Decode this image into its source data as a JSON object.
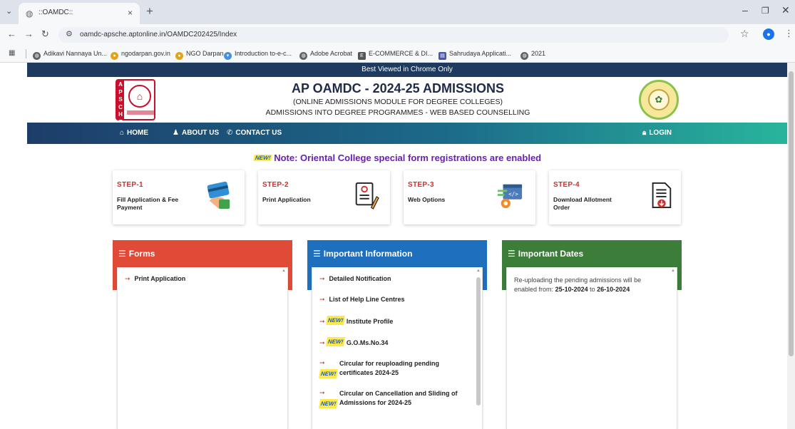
{
  "browser": {
    "tab_title": "::OAMDC::",
    "url": "oamdc-apsche.aptonline.in/OAMDC202425/Index",
    "bookmarks": [
      {
        "label": "Adikavi Nannaya Un...",
        "color": "#5f6368"
      },
      {
        "label": "ngodarpan.gov.in",
        "color": "#e3a21a"
      },
      {
        "label": "NGO Darpan",
        "color": "#e3a21a"
      },
      {
        "label": "Introduction to-e-c...",
        "color": "#4a90d9"
      },
      {
        "label": "Adobe Acrobat",
        "color": "#5f6368"
      },
      {
        "label": "E-COMMERCE & DI...",
        "color": "#555555"
      },
      {
        "label": "Sahrudaya Applicati...",
        "color": "#4757b8"
      },
      {
        "label": "2021",
        "color": "#5f6368"
      }
    ]
  },
  "site": {
    "banner": "Best Viewed in Chrome Only",
    "logo_letters": "APSCHE",
    "title": "AP OAMDC - 2024-25 ADMISSIONS",
    "subtitle1": "(ONLINE ADMISSIONS MODULE FOR DEGREE COLLEGES)",
    "subtitle2": "ADMISSIONS INTO DEGREE PROGRAMMES - WEB BASED COUNSELLING"
  },
  "nav": {
    "home": "HOME",
    "about": "ABOUT US",
    "contact": "CONTACT US",
    "login": "LOGIN"
  },
  "notice": {
    "badge": "NEW!",
    "text": "Note: Oriental College special form registrations are enabled"
  },
  "steps": [
    {
      "title": "STEP-1",
      "text": "Fill Application & Fee Payment"
    },
    {
      "title": "STEP-2",
      "text": "Print Application"
    },
    {
      "title": "STEP-3",
      "text": "Web Options"
    },
    {
      "title": "STEP-4",
      "text": "Download Allotment Order"
    }
  ],
  "panels": {
    "forms": {
      "title": "Forms",
      "color": "#e04b38",
      "items": [
        "Print Application"
      ]
    },
    "info": {
      "title": "Important Information",
      "color": "#1f6fbf",
      "items": [
        {
          "text": "Detailed Notification",
          "new": false
        },
        {
          "text": "List of Help Line Centres",
          "new": false
        },
        {
          "text": "Institute Profile",
          "new": true
        },
        {
          "text": "G.O.Ms.No.34",
          "new": true
        },
        {
          "text": "Circular for reuploading pending certificates 2024-25",
          "new": true
        },
        {
          "text": "Circular on Cancellation and Sliding of Admissions for 2024-25",
          "new": true
        }
      ]
    },
    "dates": {
      "title": "Important Dates",
      "color": "#3c7d3a",
      "text_prefix": "Re-uploading the pending admissions will be enabled from:",
      "from": "25-10-2024",
      "joiner": "to",
      "to": "26-10-2024"
    }
  }
}
